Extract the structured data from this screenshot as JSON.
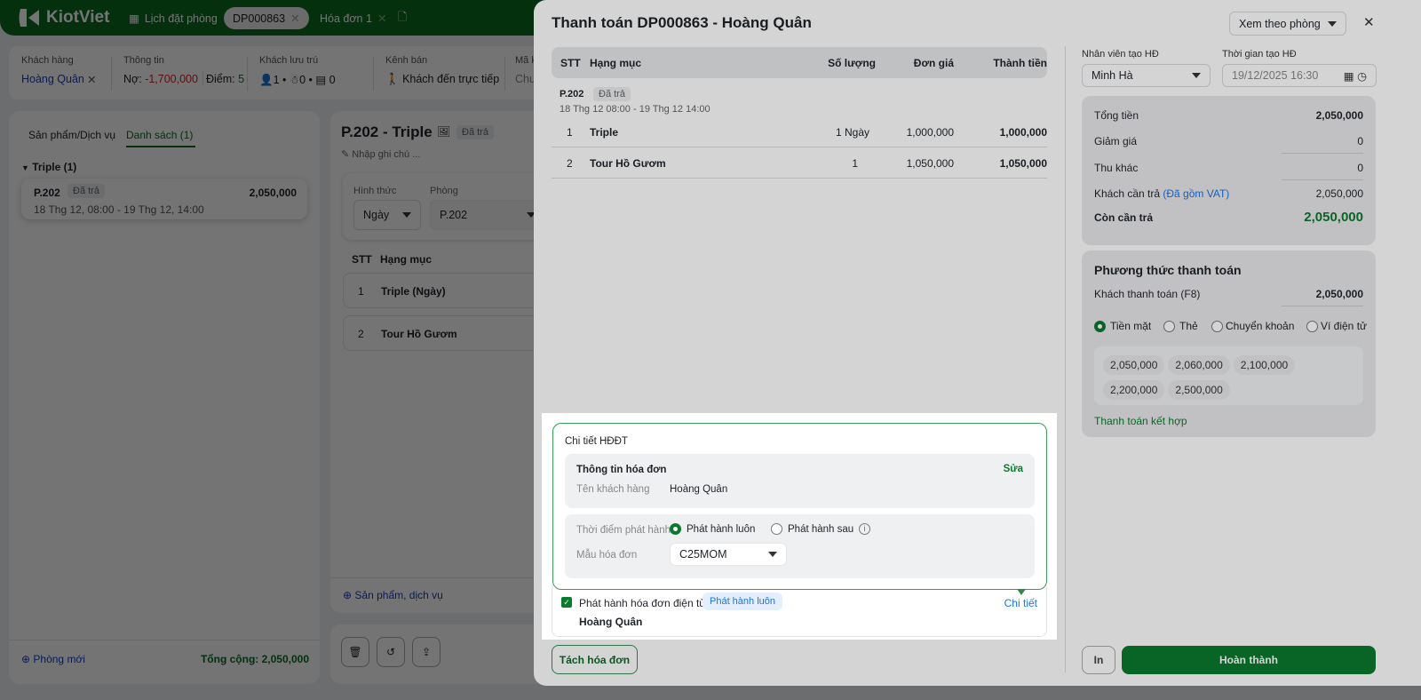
{
  "topbar": {
    "brand": "KiotViet",
    "tabs": [
      {
        "label": "Lịch đặt phòng"
      },
      {
        "label": "DP000863"
      },
      {
        "label": "Hóa đơn 1"
      }
    ]
  },
  "info": {
    "customer_label": "Khách hàng",
    "customer": "Hoàng Quân",
    "info_label": "Thông tin",
    "debt_label": "Nợ:",
    "debt": "-1,700,000",
    "points_label": "Điểm:",
    "points": "5",
    "guests_label": "Khách lưu trú",
    "adults": "1",
    "children": "0",
    "ids": "0",
    "channel_label": "Kênh bán",
    "channel": "Khách đến trực tiếp",
    "code_label": "Mã k",
    "code_val": "Chư"
  },
  "left": {
    "tabs": [
      "Sản phẩm/Dịch vụ",
      "Danh sách (1)"
    ],
    "group": "Triple (1)",
    "room": {
      "name": "P.202",
      "status": "Đã trả",
      "amount": "2,050,000",
      "time": "18 Thg 12, 08:00 - 19 Thg 12, 14:00"
    },
    "new_room": "Phòng mới",
    "total": "Tổng cộng: 2,050,000"
  },
  "middle": {
    "title": "P.202 - Triple",
    "status": "Đã trả",
    "note_placeholder": "Nhập ghi chú ...",
    "form_label": "Hình thức",
    "form_value": "Ngày",
    "room_label": "Phòng",
    "room_value": "P.202",
    "col_stt": "STT",
    "col_item": "Hạng mục",
    "items": [
      {
        "no": "1",
        "name": "Triple (Ngày)"
      },
      {
        "no": "2",
        "name": "Tour Hồ Gươm"
      }
    ],
    "add_service": "Sản phẩm, dịch vụ"
  },
  "modal": {
    "title": "Thanh toán DP000863 - Hoàng Quân",
    "view_select": "Xem theo phòng",
    "table": {
      "headers": [
        "STT",
        "Hạng mục",
        "Số lượng",
        "Đơn giá",
        "Thành tiền"
      ],
      "room": "P.202",
      "room_status": "Đã trả",
      "room_time": "18 Thg 12 08:00 - 19 Thg 12 14:00",
      "rows": [
        {
          "no": "1",
          "name": "Triple",
          "qty": "1 Ngày",
          "price": "1,000,000",
          "total": "1,000,000"
        },
        {
          "no": "2",
          "name": "Tour Hồ Gươm",
          "qty": "1",
          "price": "1,050,000",
          "total": "1,050,000"
        }
      ]
    },
    "einvoice": {
      "title": "Chi tiết HĐĐT",
      "info_title": "Thông tin hóa đơn",
      "edit": "Sửa",
      "customer_label": "Tên khách hàng",
      "customer": "Hoàng Quân",
      "time_label": "Thời điểm phát hành",
      "opt_now": "Phát hành luôn",
      "opt_later": "Phát hành sau",
      "template_label": "Mẫu hóa đơn",
      "template": "C25MOM"
    },
    "issue": {
      "label": "Phát hành hóa đơn điện tử",
      "badge": "Phát hành luôn",
      "detail": "Chi tiết",
      "customer": "Hoàng Quân",
      "checked": true
    },
    "split_button": "Tách hóa đơn",
    "staff_label": "Nhân viên tạo HĐ",
    "staff": "Minh Hà",
    "time_label": "Thời gian tạo HĐ",
    "time": "19/12/2025 16:30",
    "summary": {
      "total_label": "Tổng tiền",
      "total": "2,050,000",
      "discount_label": "Giảm giá",
      "discount": "0",
      "other_label": "Thu khác",
      "other": "0",
      "pay_label": "Khách cần trả",
      "vat": "(Đã gồm VAT)",
      "pay": "2,050,000",
      "remain_label": "Còn cần trả",
      "remain": "2,050,000"
    },
    "payment": {
      "title": "Phương thức thanh toán",
      "paid_label": "Khách thanh toán (F8)",
      "paid": "2,050,000",
      "methods": [
        "Tiền mặt",
        "Thẻ",
        "Chuyển khoản",
        "Ví điện tử"
      ],
      "suggestions": [
        "2,050,000",
        "2,060,000",
        "2,100,000",
        "2,200,000",
        "2,500,000"
      ],
      "combined": "Thanh toán kết hợp"
    },
    "print": "In",
    "finish": "Hoàn thành"
  },
  "colors": {
    "brand": "#0b6b22",
    "accent_green": "#0b7a2e",
    "link_blue": "#1a73e8",
    "debt_red": "#d21f1f"
  }
}
